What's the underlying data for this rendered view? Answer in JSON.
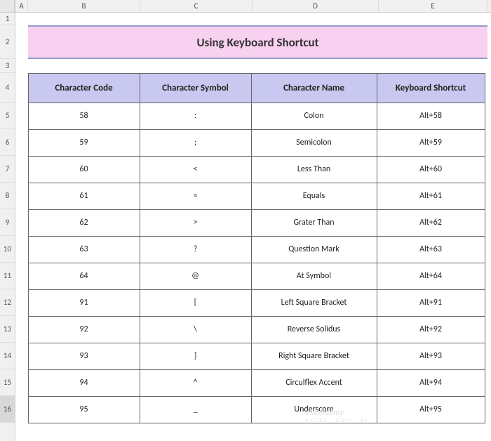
{
  "title": "Using Keyboard Shortcut",
  "columns": [
    "A",
    "B",
    "C",
    "D",
    "E"
  ],
  "rows": [
    "1",
    "2",
    "3",
    "4",
    "5",
    "6",
    "7",
    "8",
    "9",
    "10",
    "11",
    "12",
    "13",
    "14",
    "15",
    "16"
  ],
  "selectedRow": "16",
  "headers": {
    "b": "Character Code",
    "c": "Character Symbol",
    "d": "Character Name",
    "e": "Keyboard Shortcut"
  },
  "data": [
    {
      "code": "58",
      "symbol": ":",
      "name": "Colon",
      "shortcut": "Alt+58"
    },
    {
      "code": "59",
      "symbol": ";",
      "name": "Semicolon",
      "shortcut": "Alt+59"
    },
    {
      "code": "60",
      "symbol": "<",
      "name": "Less Than",
      "shortcut": "Alt+60"
    },
    {
      "code": "61",
      "symbol": "=",
      "name": "Equals",
      "shortcut": "Alt+61"
    },
    {
      "code": "62",
      "symbol": ">",
      "name": "Grater Than",
      "shortcut": "Alt+62"
    },
    {
      "code": "63",
      "symbol": "?",
      "name": "Question Mark",
      "shortcut": "Alt+63"
    },
    {
      "code": "64",
      "symbol": "@",
      "name": "At Symbol",
      "shortcut": "Alt+64"
    },
    {
      "code": "91",
      "symbol": "[",
      "name": "Left Square Bracket",
      "shortcut": "Alt+91"
    },
    {
      "code": "92",
      "symbol": "\\",
      "name": "Reverse Solidus",
      "shortcut": "Alt+92"
    },
    {
      "code": "93",
      "symbol": "]",
      "name": "Right Square Bracket",
      "shortcut": "Alt+93"
    },
    {
      "code": "94",
      "symbol": "^",
      "name": "Circulflex Accent",
      "shortcut": "Alt+94"
    },
    {
      "code": "95",
      "symbol": "_",
      "name": "Underscore",
      "shortcut": "Alt+95"
    }
  ],
  "watermark": {
    "main": "exceldemy",
    "sub": "EXCEL · DATA · BI"
  },
  "chart_data": {
    "type": "table",
    "title": "Using Keyboard Shortcut",
    "columns": [
      "Character Code",
      "Character Symbol",
      "Character Name",
      "Keyboard Shortcut"
    ],
    "rows": [
      [
        "58",
        ":",
        "Colon",
        "Alt+58"
      ],
      [
        "59",
        ";",
        "Semicolon",
        "Alt+59"
      ],
      [
        "60",
        "<",
        "Less Than",
        "Alt+60"
      ],
      [
        "61",
        "=",
        "Equals",
        "Alt+61"
      ],
      [
        "62",
        ">",
        "Grater Than",
        "Alt+62"
      ],
      [
        "63",
        "?",
        "Question Mark",
        "Alt+63"
      ],
      [
        "64",
        "@",
        "At Symbol",
        "Alt+64"
      ],
      [
        "91",
        "[",
        "Left Square Bracket",
        "Alt+91"
      ],
      [
        "92",
        "\\",
        "Reverse Solidus",
        "Alt+92"
      ],
      [
        "93",
        "]",
        "Right Square Bracket",
        "Alt+93"
      ],
      [
        "94",
        "^",
        "Circulflex Accent",
        "Alt+94"
      ],
      [
        "95",
        "_",
        "Underscore",
        "Alt+95"
      ]
    ]
  }
}
